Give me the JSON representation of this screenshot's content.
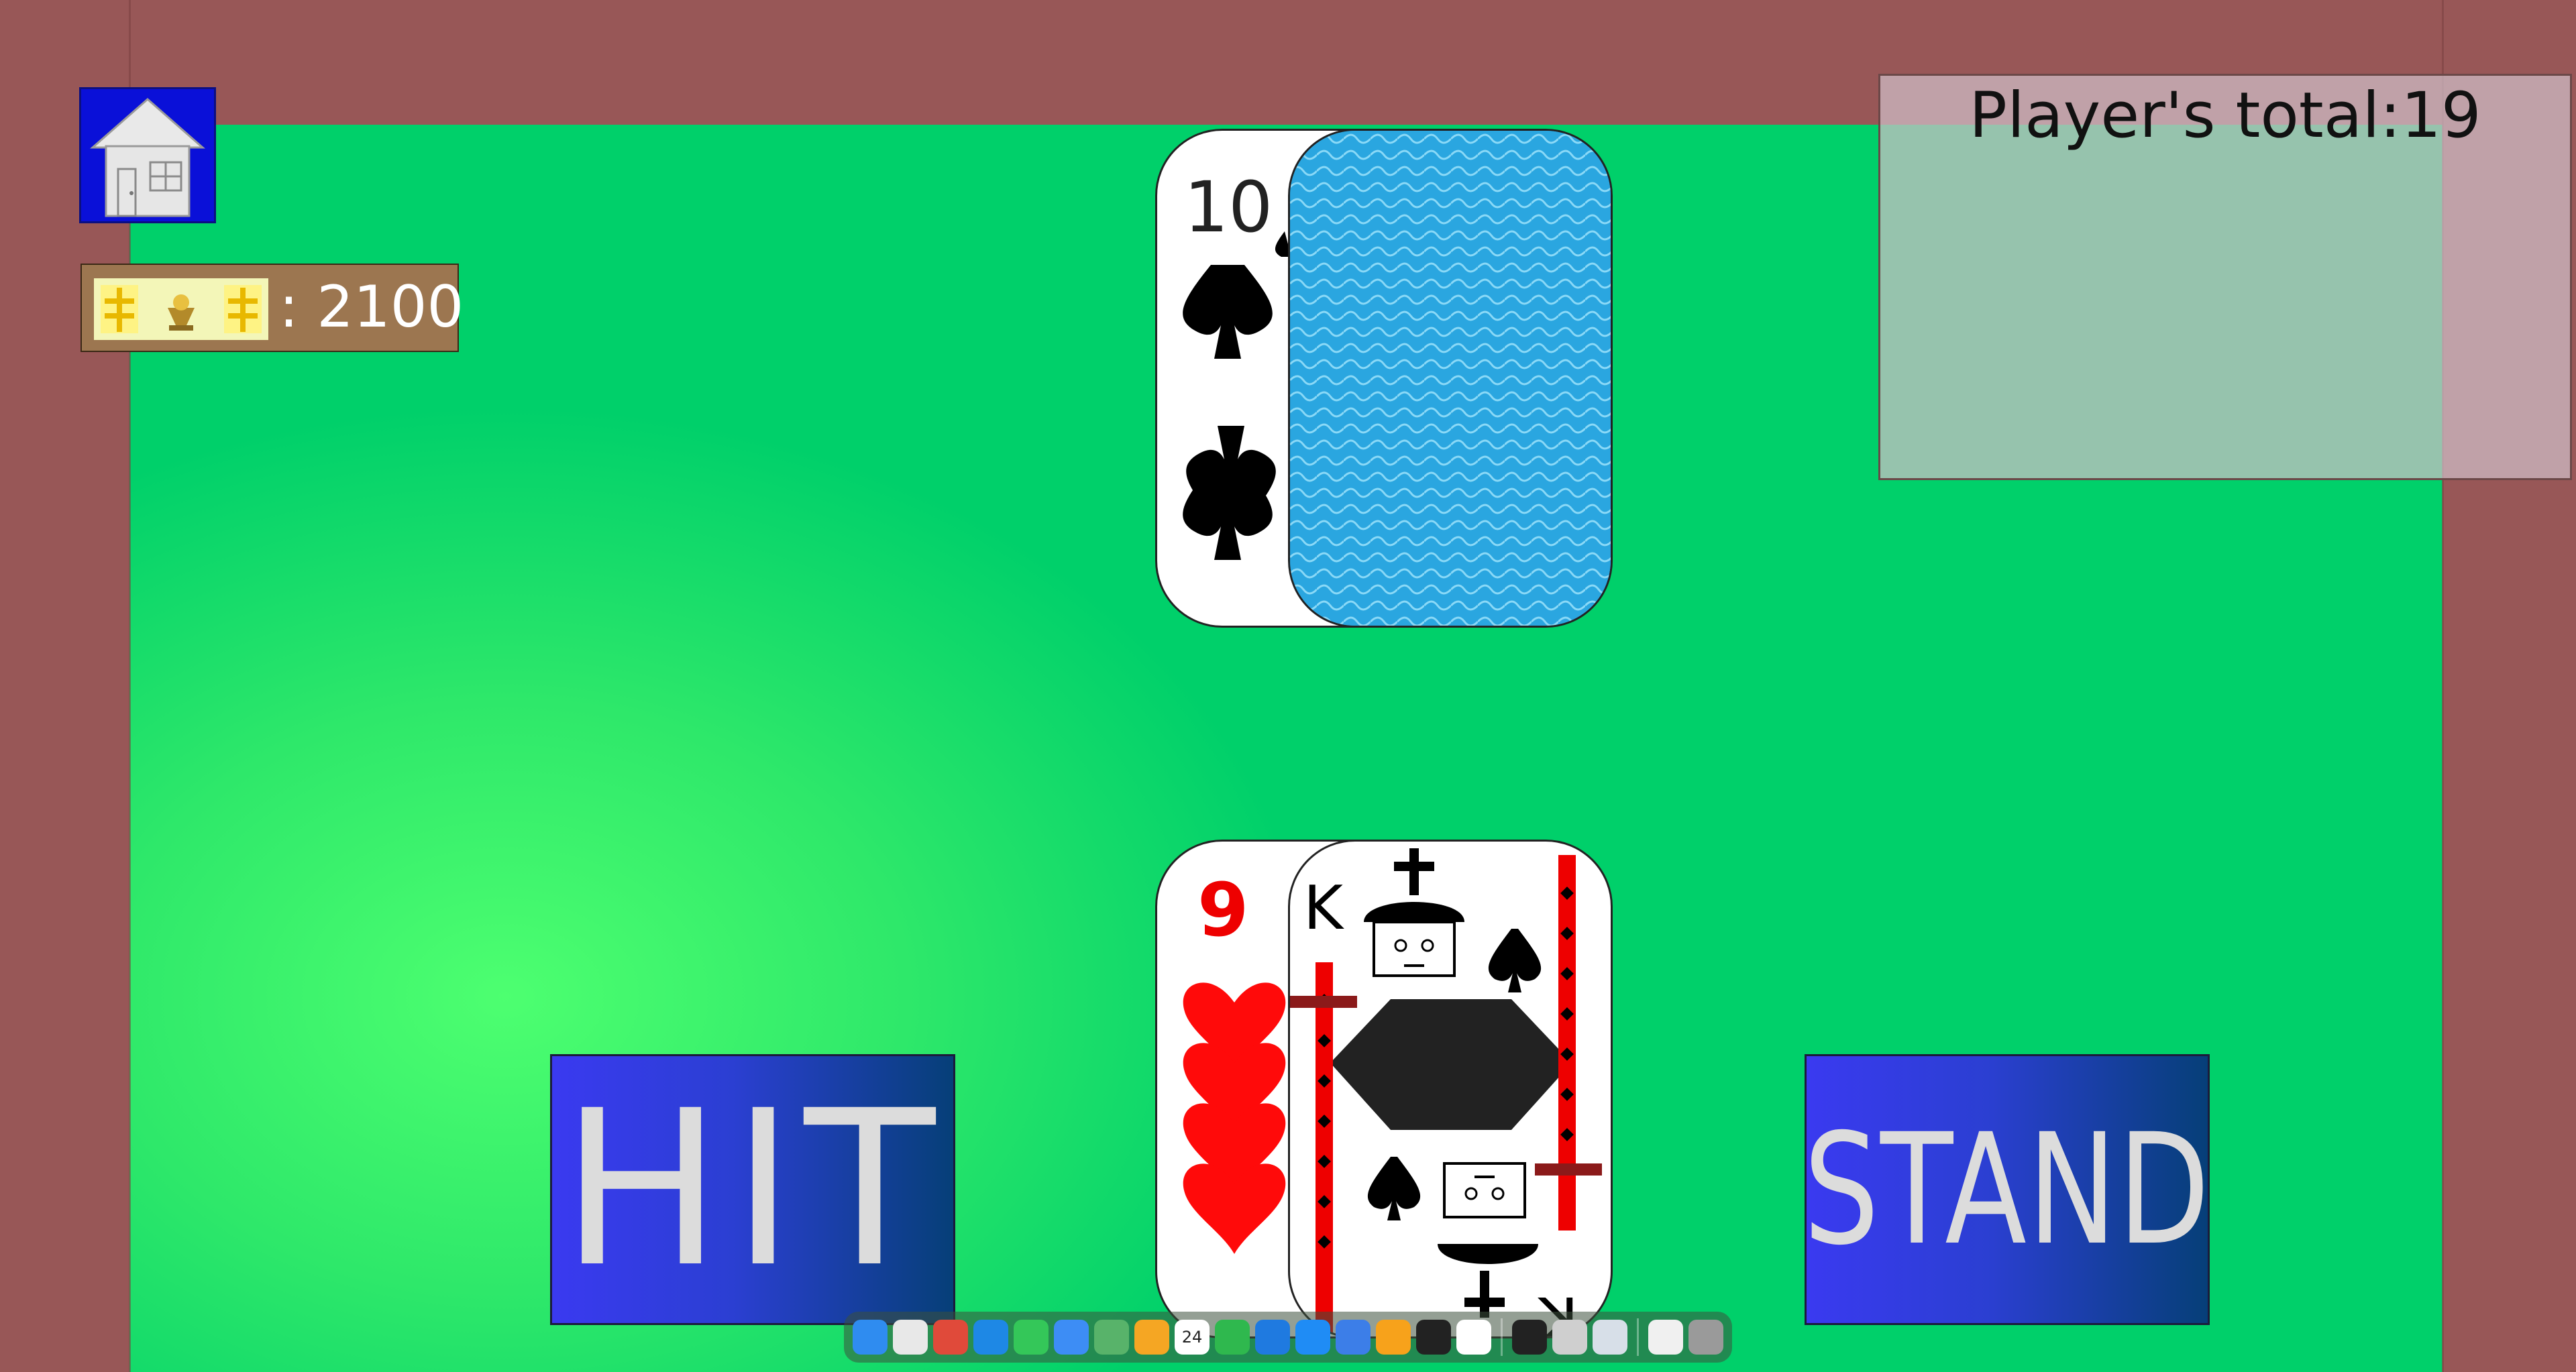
{
  "wallet": {
    "coins": ": 2100"
  },
  "scoreboard": {
    "player_total": "Player's total:19"
  },
  "dealer_hand": [
    {
      "rank": "10",
      "suit": "spades",
      "face_up": true
    },
    {
      "face_up": false
    }
  ],
  "player_hand": [
    {
      "rank": "9",
      "suit": "hearts",
      "face_up": true
    },
    {
      "rank": "K",
      "suit": "spades",
      "face_up": true
    }
  ],
  "actions": {
    "hit_label": "HIT",
    "stand_label": "STAND"
  },
  "dock": {
    "icons": [
      {
        "name": "finder-icon",
        "color": "#2f8cf0"
      },
      {
        "name": "launchpad-icon",
        "color": "#e8e8e8"
      },
      {
        "name": "chrome-icon",
        "color": "#e04a3a"
      },
      {
        "name": "safari-icon",
        "color": "#1e88e5"
      },
      {
        "name": "messages-icon",
        "color": "#34c759"
      },
      {
        "name": "mail-icon",
        "color": "#3d8df5"
      },
      {
        "name": "maps-icon",
        "color": "#58b36a"
      },
      {
        "name": "photos-icon",
        "color": "#f5a623"
      },
      {
        "name": "calendar-icon",
        "color": "#ffffff",
        "text": "24"
      },
      {
        "name": "numbers-icon",
        "color": "#2fb84e"
      },
      {
        "name": "keynote-icon",
        "color": "#1f7ae0"
      },
      {
        "name": "app-store-icon",
        "color": "#1f8cf5"
      },
      {
        "name": "xcode-icon",
        "color": "#3c7ee8"
      },
      {
        "name": "pages-icon",
        "color": "#f7a21b"
      },
      {
        "name": "chatgpt-icon",
        "color": "#222222"
      },
      {
        "name": "webex-icon",
        "color": "#ffffff"
      },
      {
        "name": "terminal-icon",
        "color": "#222222"
      },
      {
        "name": "script-editor-icon",
        "color": "#cfcfcf"
      },
      {
        "name": "preview-icon",
        "color": "#d7dfe8"
      },
      {
        "name": "document-icon",
        "color": "#f0f0f0"
      },
      {
        "name": "trash-icon",
        "color": "#9a9a9a"
      }
    ]
  },
  "colors": {
    "table_border": "#985757",
    "felt": "#00d06a",
    "button_blue": "#3a3af0",
    "button_dark": "#063f78",
    "card_back": "#2aa6e0"
  }
}
